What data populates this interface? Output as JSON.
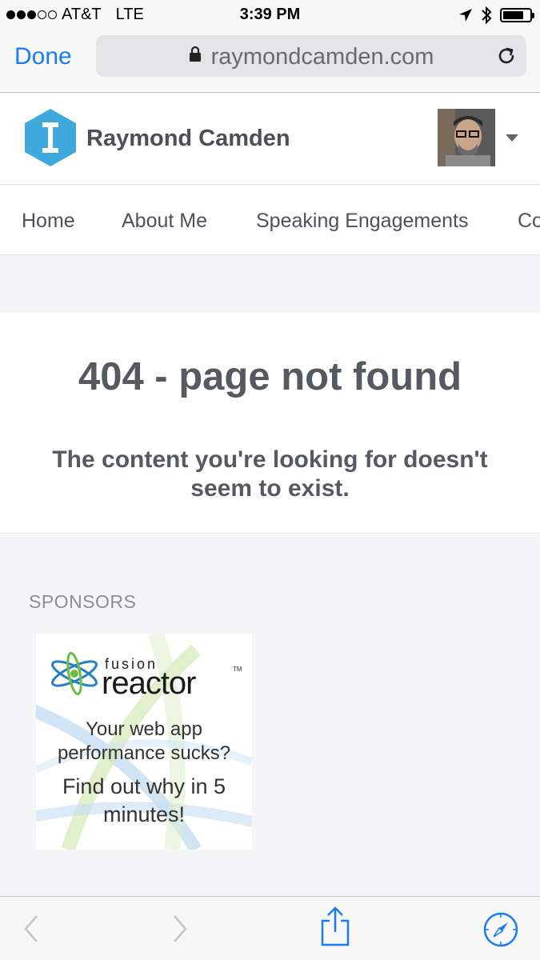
{
  "status_bar": {
    "carrier": "AT&T",
    "network": "LTE",
    "time": "3:39 PM"
  },
  "browser": {
    "done_label": "Done",
    "url": "raymondcamden.com"
  },
  "site": {
    "title": "Raymond Camden",
    "logo_letter": "I",
    "accent_color": "#3fa9dd"
  },
  "nav": {
    "items": [
      {
        "label": "Home"
      },
      {
        "label": "About Me"
      },
      {
        "label": "Speaking Engagements"
      },
      {
        "label": "Co"
      }
    ]
  },
  "error": {
    "title": "404 - page not found",
    "message": "The content you're looking for doesn't seem to exist."
  },
  "sponsors": {
    "label": "SPONSORS",
    "ad": {
      "brand_small": "fusion",
      "brand": "reactor",
      "tm": "TM",
      "line1": "Your web app",
      "line2": "performance sucks?",
      "line3": "Find out why in 5",
      "line4": "minutes!"
    }
  },
  "toolbar": {
    "icons": [
      "back-icon",
      "forward-icon",
      "share-icon",
      "compass-icon"
    ]
  }
}
